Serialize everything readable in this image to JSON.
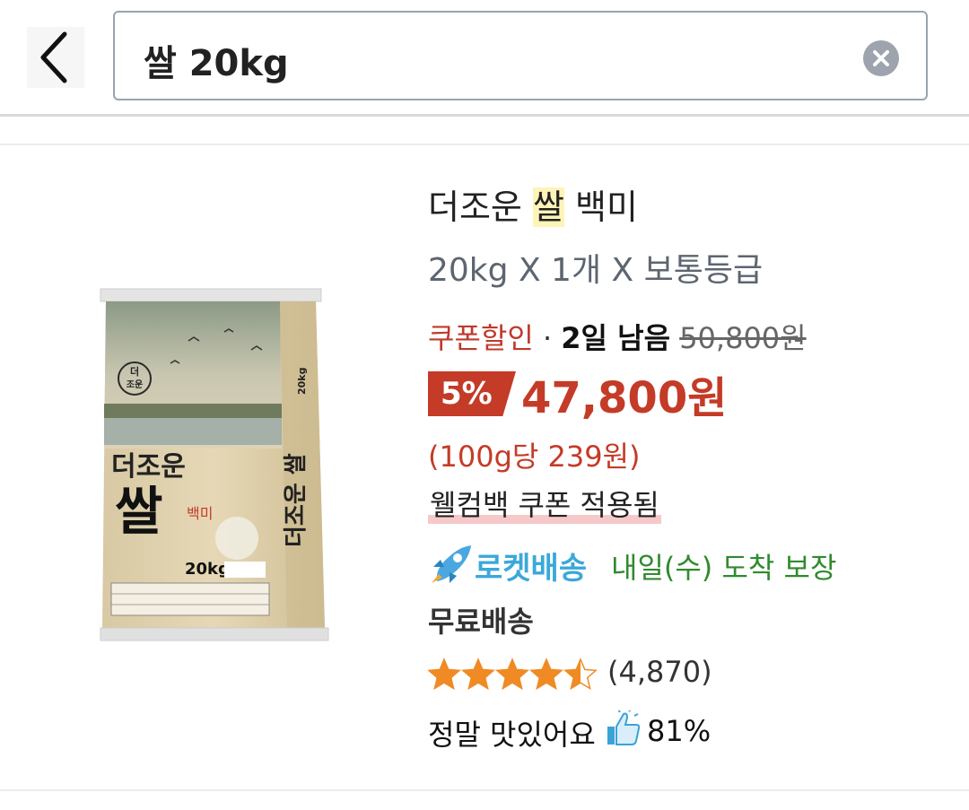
{
  "search": {
    "query": "쌀 20kg"
  },
  "icons": {
    "back": "back-arrow-icon",
    "clear": "clear-icon",
    "rocket": "rocket-icon",
    "star": "star-icon",
    "thumb": "thumbs-up-icon"
  },
  "product": {
    "title_prefix": "더조운 ",
    "title_highlight": "쌀",
    "title_suffix": " 백미",
    "option": "20kg X 1개 X 보통등급",
    "coupon_label": "쿠폰할인",
    "separator": "·",
    "days_left": "2일 남음",
    "original_price": "50,800원",
    "discount": "5%",
    "price": "47,800원",
    "unit_price": "(100g당 239원)",
    "coupon_applied": "웰컴백 쿠폰 적용됨",
    "rocket_label": "로켓배송",
    "delivery": "내일(수) 도착 보장",
    "free_shipping": "무료배송",
    "rating": 4.5,
    "review_count": "(4,870)",
    "taste_label": "정말 맛있어요",
    "taste_percent": "81%"
  },
  "image": {
    "brand": "더조운",
    "name": "쌀",
    "sub": "백미",
    "weight": "20kg",
    "side_text": "더조운 쌀",
    "side_weight": "20kg",
    "logo_text": "더조운"
  },
  "colors": {
    "accent": "#c43b27",
    "rocket": "#3ba8d9",
    "delivery": "#2f8a2f",
    "star": "#f08a24"
  }
}
